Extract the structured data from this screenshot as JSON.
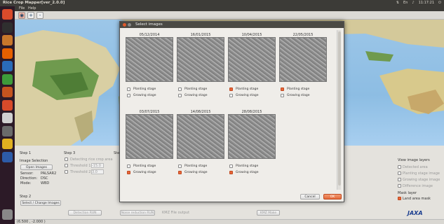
{
  "window": {
    "title": "Rice Crop Mapper[ver_2.0.0]"
  },
  "tray": {
    "lang": "En",
    "clock": "11:17:21"
  },
  "menu": {
    "file": "File",
    "help": "Help"
  },
  "launcher": {
    "items": [
      {
        "icon": "ubuntu-dash-icon",
        "color": "#d94b2b"
      },
      {
        "icon": "terminal-icon",
        "color": "#2f2f2f"
      },
      {
        "icon": "files-icon",
        "color": "#c8772b"
      },
      {
        "icon": "firefox-icon",
        "color": "#e66000"
      },
      {
        "icon": "writer-icon",
        "color": "#2a6bb8"
      },
      {
        "icon": "calc-icon",
        "color": "#3d9b3a"
      },
      {
        "icon": "impress-icon",
        "color": "#c4541f"
      },
      {
        "icon": "software-center-icon",
        "color": "#d84a2a"
      },
      {
        "icon": "amazon-icon",
        "color": "#d0d0d0"
      },
      {
        "icon": "settings-icon",
        "color": "#6a6a6a"
      },
      {
        "icon": "mapper-icon",
        "color": "#e0b020"
      },
      {
        "icon": "rice-app-icon",
        "color": "#2d5ba8"
      }
    ],
    "bottom": {
      "icon": "trash-icon",
      "color": "#888888"
    }
  },
  "toolbar": {
    "zoom_in": "+",
    "zoom_out": "-"
  },
  "panel": {
    "step1": "Step 1",
    "image_selection": "Image Selection",
    "open_images": "Open Images",
    "sensor_label": "Sensor:",
    "sensor_value": "PALSAR2",
    "direction_label": "Direction:",
    "direction_value": "DSC",
    "mode_label": "Mode:",
    "mode_value": "WBD",
    "step2": "Step 2",
    "select_change": "Select / Change Images",
    "step3": "Step 3",
    "detecting": "Detecting rice crop area",
    "threshold1": "Threshold 1",
    "threshold1_value": "-15.0",
    "threshold2": "Threshold 2",
    "threshold2_value": "3.0",
    "step_partial": "Step",
    "detection_run": "Detection RUN",
    "noise_reduction": "Noise reduction RUN",
    "kmz_output": "KMZ File output",
    "kmz_make": "KMZ Make",
    "view_layers": "View image layers",
    "layers": [
      {
        "label": "Detected area",
        "checked": false,
        "enabled": false
      },
      {
        "label": "Planting stage image",
        "checked": false,
        "enabled": false
      },
      {
        "label": "Growing stage image",
        "checked": false,
        "enabled": false
      },
      {
        "label": "Difference image",
        "checked": false,
        "enabled": false
      }
    ],
    "mask_layer": "Mask layer",
    "land_area_mask": "Land area mask",
    "logo": "JAXA"
  },
  "status": {
    "coords": "(6.500 , -2.000 )"
  },
  "dialog": {
    "title": "Select images",
    "planting": "Planting stage",
    "growing": "Growing stage",
    "cancel": "Cancel",
    "ok": "OK",
    "images": [
      {
        "date": "05/12/2014",
        "planting": false,
        "growing": false
      },
      {
        "date": "16/01/2015",
        "planting": false,
        "growing": false
      },
      {
        "date": "10/04/2015",
        "planting": true,
        "growing": false
      },
      {
        "date": "22/05/2015",
        "planting": true,
        "growing": false
      },
      {
        "date": "03/07/2015",
        "planting": false,
        "growing": true
      },
      {
        "date": "14/08/2015",
        "planting": false,
        "growing": true
      },
      {
        "date": "28/08/2015",
        "planting": false,
        "growing": true
      }
    ]
  }
}
